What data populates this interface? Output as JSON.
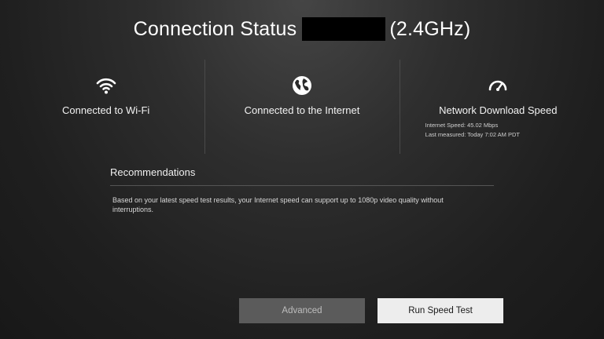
{
  "header": {
    "title": "Connection Status",
    "band": "(2.4GHz)"
  },
  "panels": [
    {
      "icon": "wifi-icon",
      "label": "Connected to Wi-Fi"
    },
    {
      "icon": "globe-icon",
      "label": "Connected to the Internet"
    },
    {
      "icon": "speedometer-icon",
      "label": "Network Download Speed",
      "internet_speed": "Internet Speed: 45.02 Mbps",
      "last_measured": "Last measured: Today 7:02 AM PDT"
    }
  ],
  "recommendations": {
    "title": "Recommendations",
    "text": "Based on your latest speed test results, your Internet speed can support up to 1080p video quality without interruptions."
  },
  "buttons": {
    "advanced": "Advanced",
    "run_speed_test": "Run Speed Test"
  },
  "colors": {
    "background": "#1f1f1f",
    "divider": "#4a4a4a",
    "button_disabled": "#5b5b5b",
    "button_focused": "#ededed"
  }
}
